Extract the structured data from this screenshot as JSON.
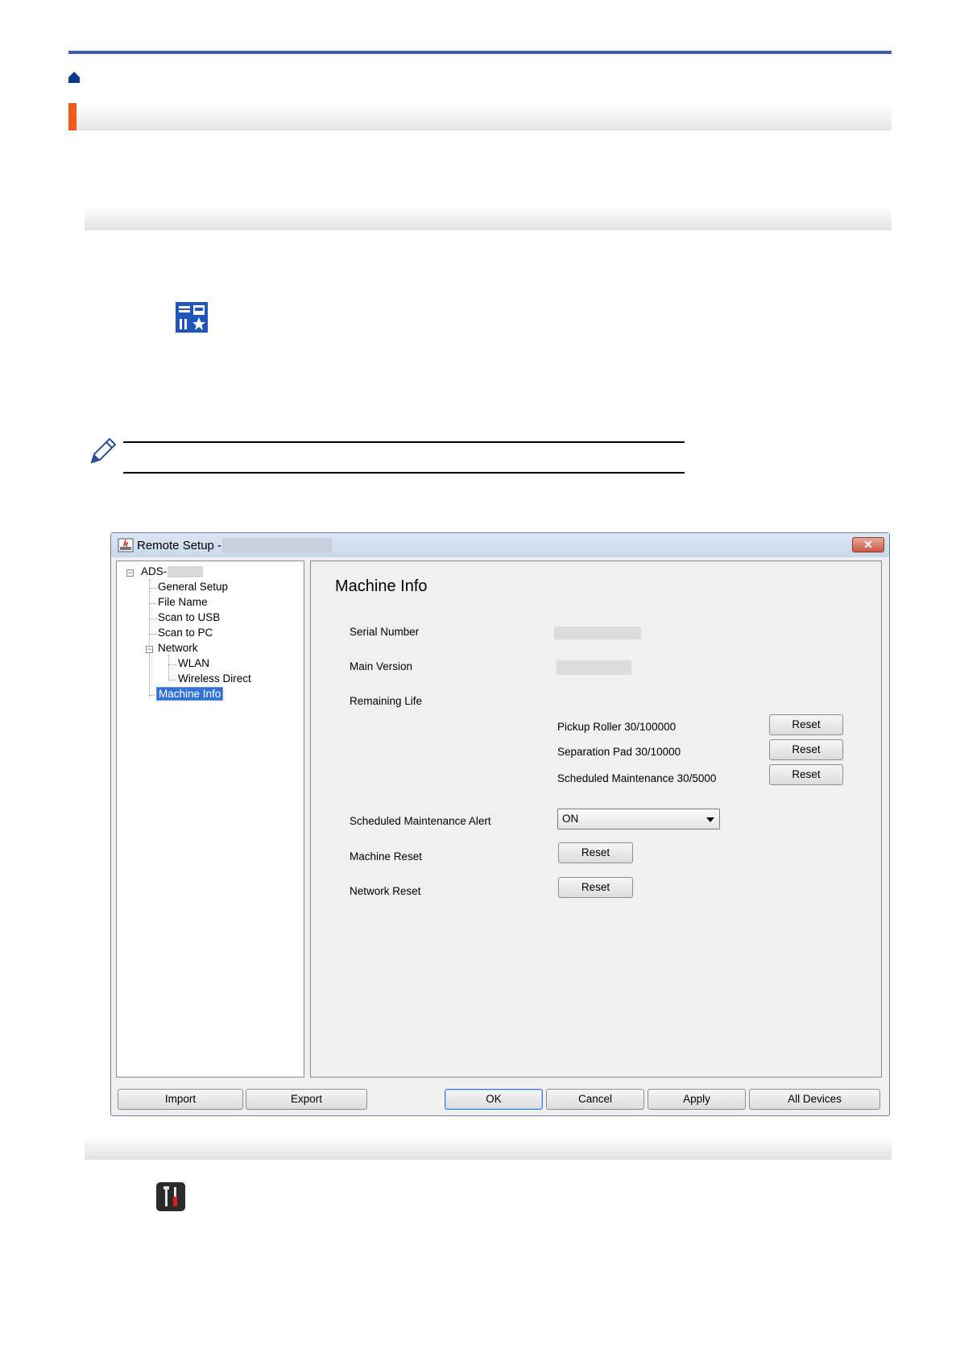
{
  "dialog": {
    "title": "Remote Setup -",
    "close_label": "✕",
    "tree": {
      "root": "ADS-",
      "items": [
        "General Setup",
        "File Name",
        "Scan to USB",
        "Scan to PC",
        "Network",
        "WLAN",
        "Wireless Direct",
        "Machine Info"
      ],
      "selected": "Machine Info"
    },
    "panel": {
      "title": "Machine Info",
      "serial_number_label": "Serial Number",
      "main_version_label": "Main Version",
      "remaining_life_label": "Remaining Life",
      "pickup_roller": "Pickup Roller 30/100000",
      "separation_pad": "Separation Pad 30/10000",
      "scheduled_maintenance": "Scheduled Maintenance 30/5000",
      "reset_label": "Reset",
      "alert_label": "Scheduled Maintenance Alert",
      "alert_value": "ON",
      "machine_reset_label": "Machine Reset",
      "network_reset_label": "Network Reset"
    },
    "footer": {
      "import": "Import",
      "export": "Export",
      "ok": "OK",
      "cancel": "Cancel",
      "apply": "Apply",
      "all_devices": "All Devices"
    }
  },
  "icons": {
    "home": "home-icon",
    "app": "remote-setup-app-icon",
    "note": "pencil-icon",
    "tools": "tools-icon"
  },
  "colors": {
    "accent": "#f05a1a",
    "topline": "#3a5cb8",
    "selection": "#3371d6"
  }
}
